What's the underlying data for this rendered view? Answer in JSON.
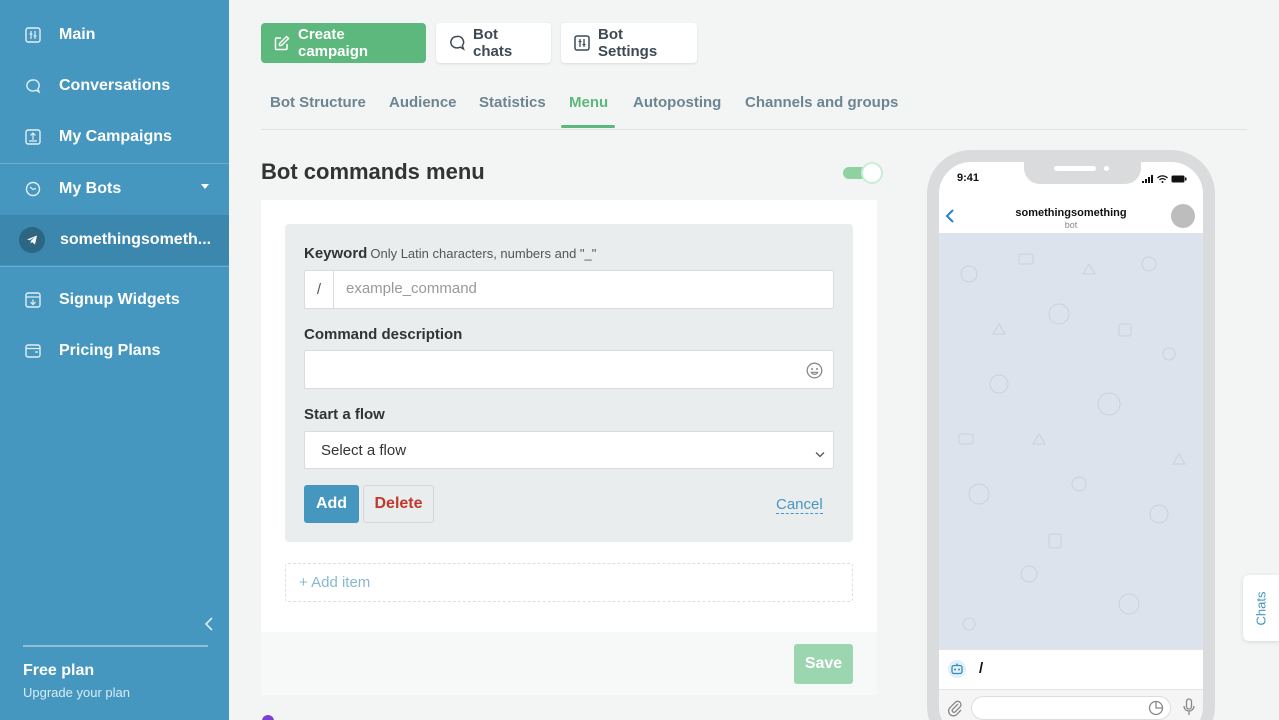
{
  "sidebar": {
    "items": [
      {
        "label": "Main",
        "icon": "dashboard-icon"
      },
      {
        "label": "Conversations",
        "icon": "chat-bubble-icon"
      },
      {
        "label": "My Campaigns",
        "icon": "campaign-icon"
      },
      {
        "label": "My Bots",
        "icon": "bot-icon"
      },
      {
        "label": "somethingsometh...",
        "icon": "telegram-icon"
      },
      {
        "label": "Signup Widgets",
        "icon": "widget-icon"
      },
      {
        "label": "Pricing Plans",
        "icon": "wallet-icon"
      }
    ],
    "plan_name": "Free plan",
    "plan_upgrade": "Upgrade your plan"
  },
  "toolbar": {
    "create_campaign": "Create campaign",
    "bot_chats": "Bot chats",
    "bot_settings": "Bot Settings"
  },
  "tabs": [
    {
      "label": "Bot Structure"
    },
    {
      "label": "Audience"
    },
    {
      "label": "Statistics"
    },
    {
      "label": "Menu",
      "active": true
    },
    {
      "label": "Autoposting"
    },
    {
      "label": "Channels and groups"
    }
  ],
  "page": {
    "title": "Bot commands menu",
    "menu_enabled": true
  },
  "form": {
    "keyword_label": "Keyword",
    "keyword_hint": "Only Latin characters, numbers and \"_\"",
    "keyword_prefix": "/",
    "keyword_placeholder": "example_command",
    "keyword_value": "",
    "description_label": "Command description",
    "description_value": "",
    "flow_label": "Start a flow",
    "flow_selected": "Select a flow",
    "add": "Add",
    "delete": "Delete",
    "cancel": "Cancel",
    "add_item": "+ Add item",
    "save": "Save"
  },
  "phone": {
    "time": "9:41",
    "chat_title": "somethingsomething",
    "chat_subtitle": "bot",
    "command_text": "/"
  },
  "chats_tab": "Chats",
  "colors": {
    "sidebar": "#4597bf",
    "accent_green": "#5cb87c",
    "accent_blue": "#4597bf",
    "danger": "#c0392b"
  }
}
